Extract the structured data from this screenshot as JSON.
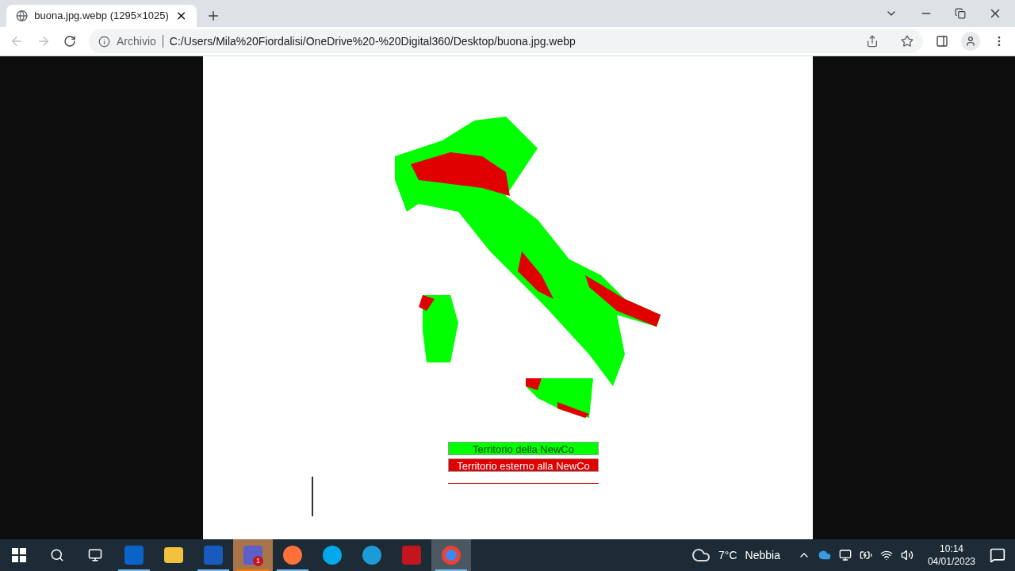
{
  "tab": {
    "title": "buona.jpg.webp (1295×1025)"
  },
  "address_bar": {
    "scheme_label": "Archivio",
    "url": "C:/Users/Mila%20Fiordalisi/OneDrive%20-%20Digital360/Desktop/buona.jpg.webp"
  },
  "image": {
    "legend": [
      {
        "label": "Territorio della NewCo",
        "color": "#00ff00"
      },
      {
        "label": "Territorio esterno alla NewCo",
        "color": "#e00000"
      }
    ]
  },
  "taskbar": {
    "apps": [
      {
        "kind": "outlook",
        "running": true,
        "active": false,
        "flashing": false
      },
      {
        "kind": "explorer",
        "running": false,
        "active": false,
        "flashing": false
      },
      {
        "kind": "word",
        "running": true,
        "active": false,
        "flashing": false
      },
      {
        "kind": "teams",
        "running": true,
        "active": false,
        "flashing": true,
        "badge": "1"
      },
      {
        "kind": "firefox",
        "running": true,
        "active": false,
        "flashing": false
      },
      {
        "kind": "skype",
        "running": false,
        "active": false,
        "flashing": false
      },
      {
        "kind": "edge",
        "running": false,
        "active": false,
        "flashing": false
      },
      {
        "kind": "acrobat",
        "running": false,
        "active": false,
        "flashing": false
      },
      {
        "kind": "chrome",
        "running": true,
        "active": true,
        "flashing": false
      }
    ],
    "weather": {
      "temperature": "7°C",
      "condition": "Nebbia"
    },
    "clock": {
      "time": "10:14",
      "date": "04/01/2023"
    }
  }
}
